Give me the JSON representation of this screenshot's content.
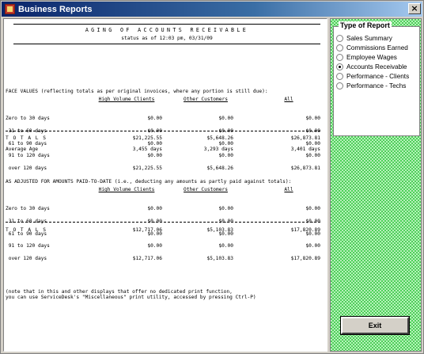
{
  "window": {
    "title": "Business Reports",
    "close_label": "×"
  },
  "report": {
    "title": "AGING OF ACCOUNTS RECEIVABLE",
    "status": "status as of 12:03 pm, 03/31/09",
    "face_heading": "FACE VALUES (reflecting totals as per original invoices, where any portion is still due):",
    "adjusted_heading": "AS ADJUSTED FOR AMOUNTS PAID-TO-DATE (i.e., deducting any amounts as partly paid against totals):",
    "columns": [
      "High Volume Clients",
      "Other Customers",
      "All"
    ],
    "row_labels": [
      "Zero to 30 days",
      " 31 to 60 days",
      " 61 to 90 days",
      " 91 to 120 days",
      " over 120 days"
    ],
    "face": {
      "high_volume": [
        "$0.00",
        "$0.00",
        "$0.00",
        "$0.00",
        "$21,225.55"
      ],
      "other": [
        "$0.00",
        "$0.00",
        "$0.00",
        "$0.00",
        "$5,648.26"
      ],
      "all": [
        "$0.00",
        "$0.00",
        "$0.00",
        "$0.00",
        "$26,873.81"
      ],
      "totals_label": "T O T A L S",
      "totals": [
        "$21,225.55",
        "$5,648.26",
        "$26,873.81"
      ],
      "avg_label": "Average Age",
      "avg": [
        "3,455 days",
        "3,293 days",
        "3,401 days"
      ]
    },
    "adjusted": {
      "high_volume": [
        "$0.00",
        "$0.00",
        "$0.00",
        "$0.00",
        "$12,717.06"
      ],
      "other": [
        "$0.00",
        "$0.00",
        "$0.00",
        "$0.00",
        "$5,103.83"
      ],
      "all": [
        "$0.00",
        "$0.00",
        "$0.00",
        "$0.00",
        "$17,820.89"
      ],
      "totals_label": "T O T A L S",
      "totals": [
        "$12,717.06",
        "$5,103.83",
        "$17,820.89"
      ]
    },
    "note_line1": "(note that in this and other displays that offer no dedicated print function,",
    "note_line2": "you can use ServiceDesk's \"Miscellaneous\" print utility, accessed by pressing Ctrl-P)"
  },
  "side": {
    "group_title": "Type of Report",
    "options": [
      {
        "label": "Sales Summary",
        "checked": false
      },
      {
        "label": "Commissions Earned",
        "checked": false
      },
      {
        "label": "Employee Wages",
        "checked": false
      },
      {
        "label": "Accounts Receivable",
        "checked": true
      },
      {
        "label": "Performance - Clients",
        "checked": false
      },
      {
        "label": "Performance - Techs",
        "checked": false
      }
    ],
    "exit_label": "Exit"
  },
  "colors": {
    "title_bar": "#0a246a",
    "panel_green": "#4fcf5a",
    "panel_light": "#b6f2ba"
  }
}
